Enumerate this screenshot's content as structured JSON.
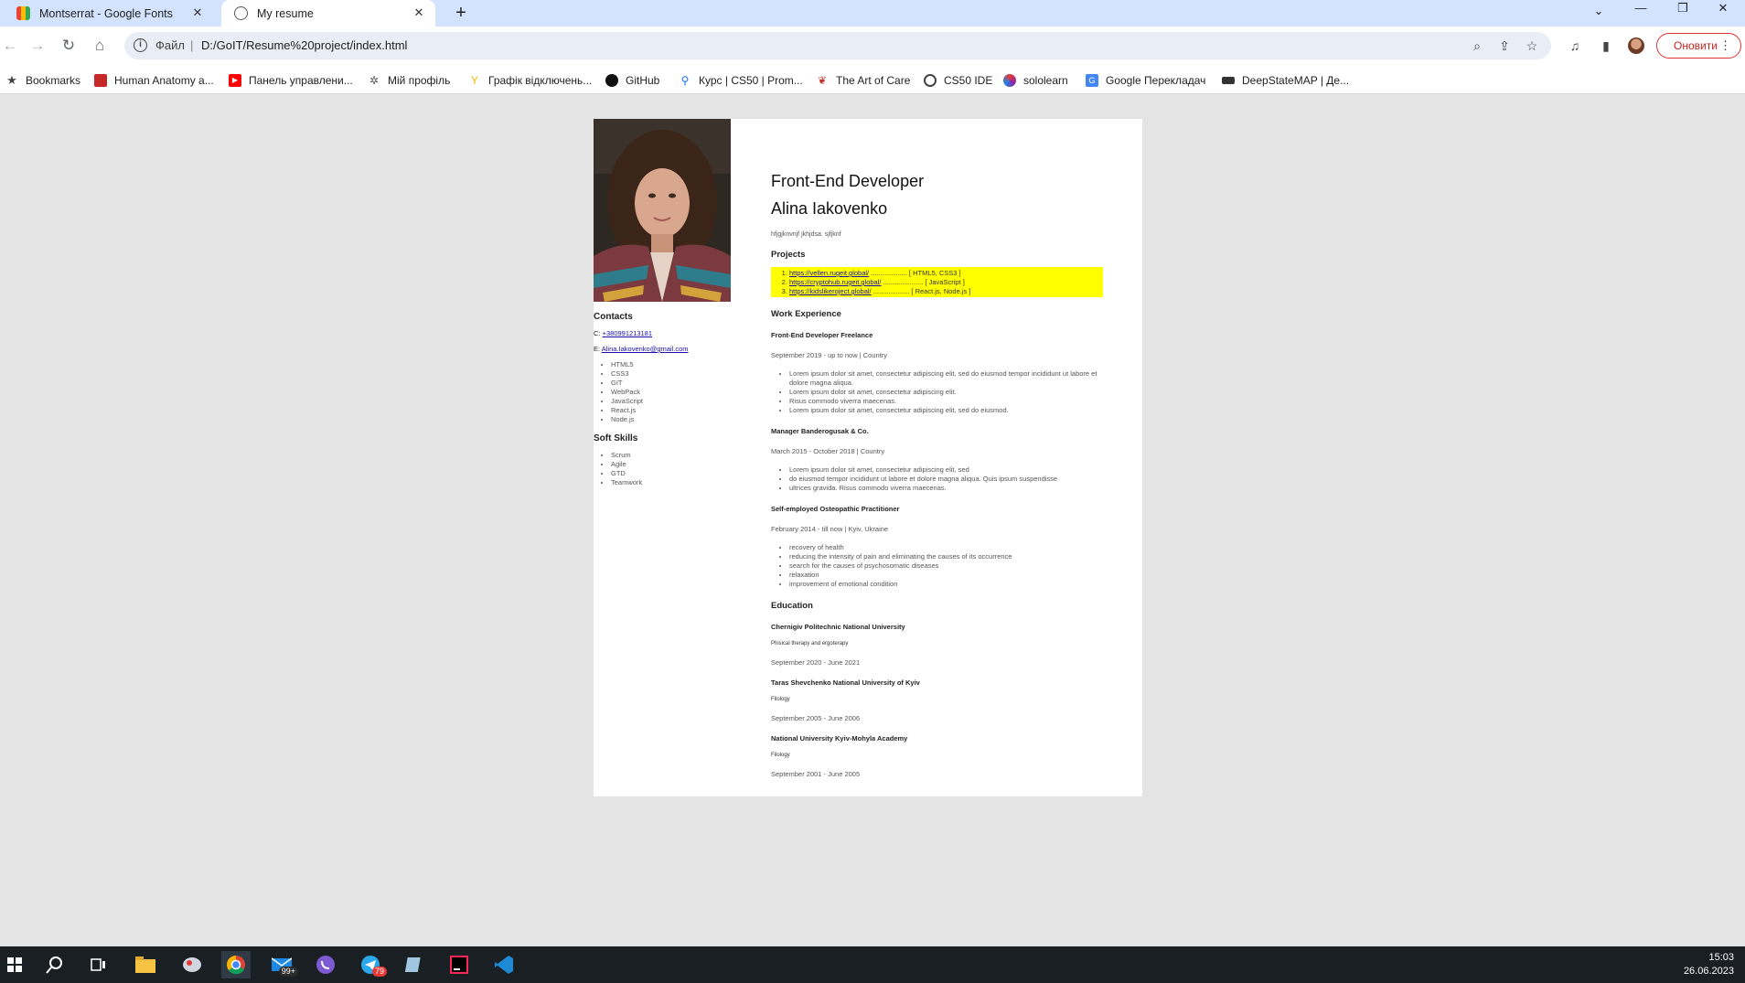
{
  "browser": {
    "tabs": [
      {
        "title": "Montserrat - Google Fonts"
      },
      {
        "title": "My resume"
      }
    ],
    "address": {
      "scheme": "Файл",
      "url": "D:/GoIT/Resume%20project/index.html"
    },
    "update_button": "Оновити",
    "bookmarks": [
      {
        "label": "Bookmarks",
        "icon": "star-icon"
      },
      {
        "label": "Human Anatomy a...",
        "icon": "anatomy-icon"
      },
      {
        "label": "Панель управлени...",
        "icon": "youtube-icon"
      },
      {
        "label": "Мій профіль",
        "icon": "network-icon"
      },
      {
        "label": "Графік відключень...",
        "icon": "power-icon"
      },
      {
        "label": "GitHub",
        "icon": "github-icon"
      },
      {
        "label": "Курс | CS50 | Prom...",
        "icon": "prometheus-icon"
      },
      {
        "label": "The Art of Care",
        "icon": "art-of-care-icon"
      },
      {
        "label": "CS50 IDE",
        "icon": "cs50-icon"
      },
      {
        "label": "sololearn",
        "icon": "sololearn-icon"
      },
      {
        "label": "Google Перекладач",
        "icon": "translate-icon"
      },
      {
        "label": "DeepStateMAP | Де...",
        "icon": "deepstate-icon"
      }
    ]
  },
  "resume": {
    "job_title": "Front-End Developer",
    "name": "Alina Iakovenko",
    "tagline": "hfjgjknvnjf jkhjdsa. sjfjknf",
    "contacts": {
      "heading": "Contacts",
      "phone_prefix": "C:",
      "phone": "+380991213181",
      "email_prefix": "E:",
      "email": "Alina.Iakovenko@gmail.com"
    },
    "tech_skills": [
      "HTML5",
      "CSS3",
      "GIT",
      "WebPack",
      "JavaScript",
      "React.js",
      "Node.js"
    ],
    "soft_skills_heading": "Soft Skills",
    "soft_skills": [
      "Scrum",
      "Agile",
      "GTD",
      "Teamwork"
    ],
    "projects_heading": "Projects",
    "projects": [
      {
        "link": "https://vellen.rugeit.global/",
        "dots": "...................",
        "tech": "[ HTML5, CSS3 ]"
      },
      {
        "link": "https://cryptohub.rugeit.global/",
        "dots": ".....................",
        "tech": "[ JavaScript ]"
      },
      {
        "link": "https://kidslikeroject.global/",
        "dots": "...................",
        "tech": "[ React.js, Node.js ]"
      }
    ],
    "work_heading": "Work Experience",
    "jobs": [
      {
        "title": "Front-End Developer Freelance",
        "period": "September 2019 - up to now | Country",
        "items": [
          "Lorem ipsum dolor sit amet, consectetur adipiscing elit, sed do eiusmod tempor incididunt ut labore et dolore magna aliqua.",
          "Lorem ipsum dolor sit amet, consectetur adipiscing elit.",
          "Risus commodo viverra maecenas.",
          "Lorem ipsum dolor sit amet, consectetur adipiscing elit, sed do eiusmod."
        ]
      },
      {
        "title": "Manager Banderogusak & Co.",
        "period": "March 2015 - October 2018 | Country",
        "items": [
          "Lorem ipsum dolor sit amet, consectetur adipiscing elit, sed",
          "do eiusmod tempor incididunt ut labore et dolore magna aliqua. Quis ipsum suspendisse",
          "ultrices gravida. Risus commodo viverra maecenas."
        ]
      },
      {
        "title": "Self-employed Osteopathic Practitioner",
        "period": "February 2014 - till now | Kyiv, Ukraine",
        "items": [
          "recovery of health",
          "reducing the intensity of pain and eliminating the causes of its occurrence",
          "search for the causes of psychosomatic diseases",
          "relaxation",
          "improvement of emotional condition"
        ]
      }
    ],
    "education_heading": "Education",
    "education": [
      {
        "school": "Chernigiv Politechnic National University",
        "field": "Phisical therapy and ergoterapy",
        "period": "September 2020 - June 2021"
      },
      {
        "school": "Taras Shevchenko National University of Kyiv",
        "field": "Filology",
        "period": "September 2005 - June 2006"
      },
      {
        "school": "National University Kyiv-Mohyla Academy",
        "field": "Filology",
        "period": "September 2001 - June 2005"
      }
    ]
  },
  "taskbar": {
    "time": "15:03",
    "date": "26.06.2023",
    "mail_badge": "99+",
    "telegram_badge": "79"
  }
}
